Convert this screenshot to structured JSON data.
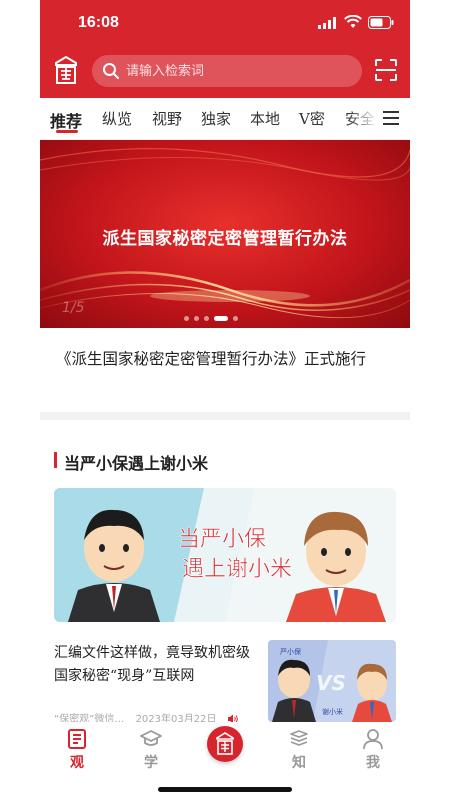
{
  "status_bar": {
    "time": "16:08"
  },
  "header": {
    "logo_icon": "seal-logo-icon",
    "search_placeholder": "请输入检索词",
    "scan_icon": "scan-icon",
    "accent_color": "#d7252d"
  },
  "tabs": {
    "items": [
      {
        "label": "推荐",
        "active": true
      },
      {
        "label": "纵览",
        "active": false
      },
      {
        "label": "视野",
        "active": false
      },
      {
        "label": "独家",
        "active": false
      },
      {
        "label": "本地",
        "active": false
      },
      {
        "label": "V密",
        "active": false
      },
      {
        "label": "安全",
        "active": false
      }
    ],
    "menu_icon": "menu-icon"
  },
  "banner": {
    "title": "派生国家秘密定密管理暂行办法",
    "counter": "1/5",
    "slide_count": 5,
    "active_slide": 3
  },
  "headline": "《派生国家秘密定密管理暂行办法》正式施行",
  "section": {
    "title": "当严小保遇上谢小米",
    "feature_image_text": [
      "当严小保",
      "遇上谢小米"
    ]
  },
  "article": {
    "title": "汇编文件这样做，竟导致机密级国家秘密“现身”互联网",
    "source": "“保密观”微信…",
    "date": "2023年03月22日",
    "thumb_labels": [
      "严小保",
      "VS",
      "谢小米"
    ]
  },
  "bottom_nav": {
    "items": [
      {
        "label": "观",
        "icon": "newspaper-icon",
        "active": true
      },
      {
        "label": "学",
        "icon": "graduation-cap-icon",
        "active": false
      },
      {
        "label": "",
        "icon": "seal-logo-icon",
        "active": false
      },
      {
        "label": "知",
        "icon": "books-icon",
        "active": false
      },
      {
        "label": "我",
        "icon": "user-icon",
        "active": false
      }
    ]
  }
}
